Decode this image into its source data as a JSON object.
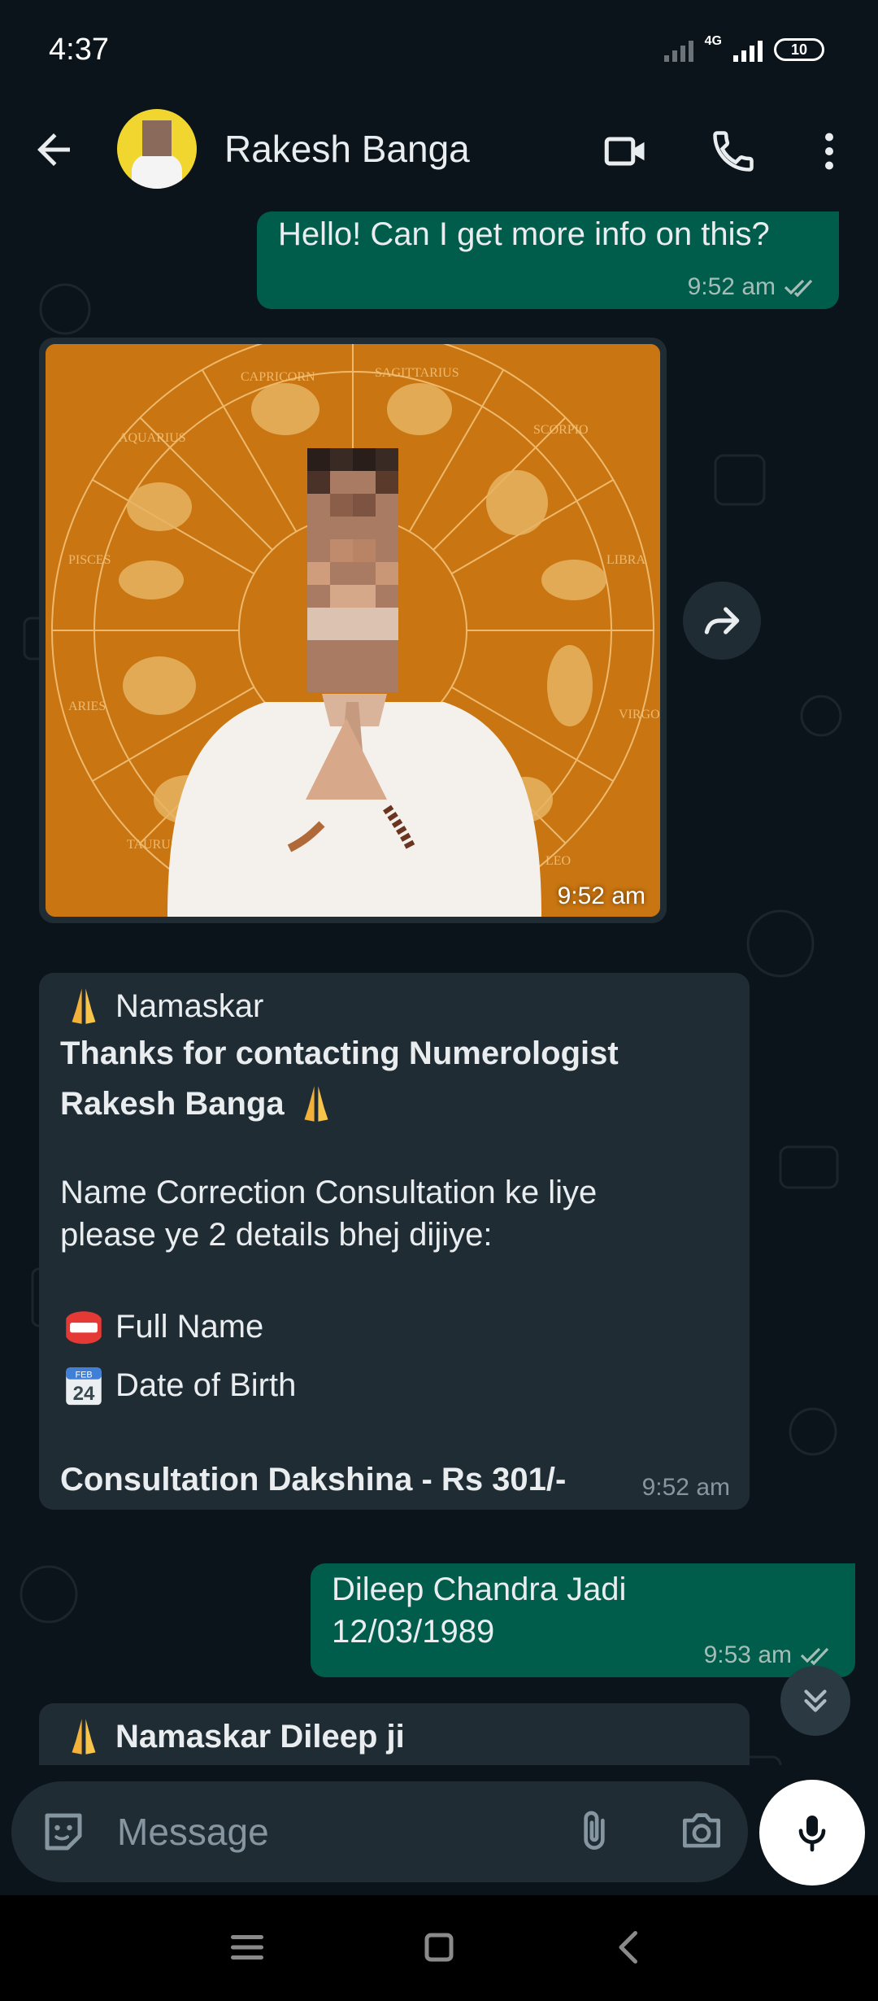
{
  "status_bar": {
    "time": "4:37",
    "network": "4G",
    "battery": "10"
  },
  "header": {
    "contact_name": "Rakesh Banga"
  },
  "messages": [
    {
      "direction": "outgoing",
      "text": "Hello! Can I get more info on this?",
      "time": "9:52 am"
    },
    {
      "direction": "incoming",
      "type": "image",
      "time": "9:52 am",
      "zodiac_labels": [
        "CAPRICORN",
        "SAGITTARIUS",
        "SCORPIO",
        "LIBRA",
        "VIRGO",
        "LEO",
        "TAURUS",
        "ARIES",
        "PISCES",
        "AQUARIUS"
      ]
    },
    {
      "direction": "incoming",
      "time": "9:52 am",
      "greeting": "Namaskar",
      "thanks_line1": "Thanks for contacting Numerologist",
      "thanks_line2": "Rakesh Banga",
      "request_line1": "Name Correction Consultation ke liye",
      "request_line2": "please ye 2 details bhej dijiye:",
      "item1": "Full Name",
      "item2": "Date of Birth",
      "calendar_month": "FEB",
      "calendar_day": "24",
      "fee": "Consultation Dakshina - Rs 301/-"
    },
    {
      "direction": "outgoing",
      "line1": "Dileep Chandra Jadi",
      "line2": "12/03/1989",
      "time": "9:53 am"
    },
    {
      "direction": "incoming",
      "text": "Namaskar Dileep ji"
    }
  ],
  "composer": {
    "placeholder": "Message"
  },
  "colors": {
    "outgoing_bubble": "#005c4b",
    "incoming_bubble": "#202c33",
    "background": "#0b141a",
    "photo_bg": "#c97511"
  },
  "icons": [
    "back-arrow-icon",
    "video-call-icon",
    "phone-icon",
    "more-options-icon",
    "forward-icon",
    "double-chevron-down-icon",
    "sticker-icon",
    "paperclip-icon",
    "camera-icon",
    "microphone-icon",
    "menu-icon",
    "home-icon",
    "back-icon"
  ]
}
